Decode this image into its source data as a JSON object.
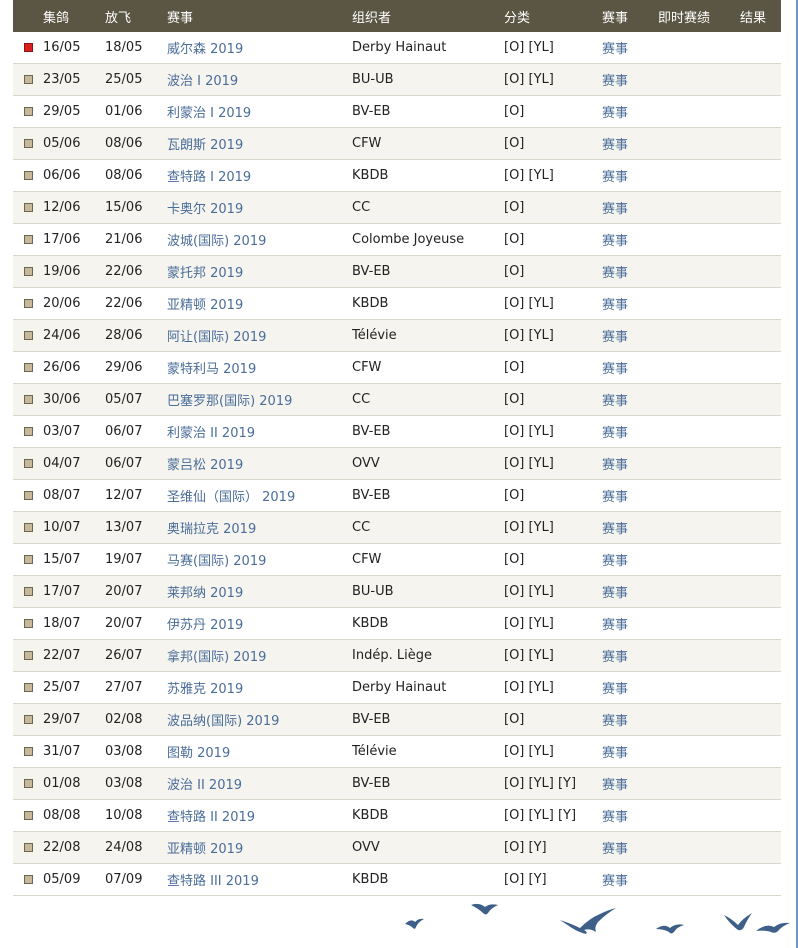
{
  "header": {
    "collect": "集鸽",
    "release": "放飞",
    "race": "赛事",
    "organizer": "组织者",
    "category": "分类",
    "race_link": "赛事",
    "live": "即时赛绩",
    "result": "结果"
  },
  "rows": [
    {
      "collect": "16/05",
      "release": "18/05",
      "race": "威尔森 2019",
      "organizer": "Derby Hainaut",
      "category": "[O] [YL]",
      "link": "赛事",
      "active": true
    },
    {
      "collect": "23/05",
      "release": "25/05",
      "race": "波治 I 2019",
      "organizer": "BU-UB",
      "category": "[O] [YL]",
      "link": "赛事"
    },
    {
      "collect": "29/05",
      "release": "01/06",
      "race": "利蒙治 I 2019",
      "organizer": "BV-EB",
      "category": "[O]",
      "link": "赛事"
    },
    {
      "collect": "05/06",
      "release": "08/06",
      "race": "瓦朗斯 2019",
      "organizer": "CFW",
      "category": "[O]",
      "link": "赛事"
    },
    {
      "collect": "06/06",
      "release": "08/06",
      "race": "查特路 I 2019",
      "organizer": "KBDB",
      "category": "[O] [YL]",
      "link": "赛事"
    },
    {
      "collect": "12/06",
      "release": "15/06",
      "race": "卡奥尔 2019",
      "organizer": "CC",
      "category": "[O]",
      "link": "赛事"
    },
    {
      "collect": "17/06",
      "release": "21/06",
      "race": "波城(国际) 2019",
      "organizer": "Colombe Joyeuse",
      "category": "[O]",
      "link": "赛事"
    },
    {
      "collect": "19/06",
      "release": "22/06",
      "race": "蒙托邦 2019",
      "organizer": "BV-EB",
      "category": "[O]",
      "link": "赛事"
    },
    {
      "collect": "20/06",
      "release": "22/06",
      "race": "亚精顿 2019",
      "organizer": "KBDB",
      "category": "[O] [YL]",
      "link": "赛事"
    },
    {
      "collect": "24/06",
      "release": "28/06",
      "race": "阿让(国际) 2019",
      "organizer": "Télévie",
      "category": "[O] [YL]",
      "link": "赛事"
    },
    {
      "collect": "26/06",
      "release": "29/06",
      "race": "蒙特利马 2019",
      "organizer": "CFW",
      "category": "[O]",
      "link": "赛事"
    },
    {
      "collect": "30/06",
      "release": "05/07",
      "race": "巴塞罗那(国际) 2019",
      "organizer": "CC",
      "category": "[O]",
      "link": "赛事"
    },
    {
      "collect": "03/07",
      "release": "06/07",
      "race": "利蒙治 II 2019",
      "organizer": "BV-EB",
      "category": "[O] [YL]",
      "link": "赛事"
    },
    {
      "collect": "04/07",
      "release": "06/07",
      "race": "蒙吕松 2019",
      "organizer": "OVV",
      "category": "[O] [YL]",
      "link": "赛事"
    },
    {
      "collect": "08/07",
      "release": "12/07",
      "race": "圣维仙（国际） 2019",
      "organizer": "BV-EB",
      "category": "[O]",
      "link": "赛事"
    },
    {
      "collect": "10/07",
      "release": "13/07",
      "race": "奥瑞拉克 2019",
      "organizer": "CC",
      "category": "[O] [YL]",
      "link": "赛事"
    },
    {
      "collect": "15/07",
      "release": "19/07",
      "race": "马赛(国际) 2019",
      "organizer": "CFW",
      "category": "[O]",
      "link": "赛事"
    },
    {
      "collect": "17/07",
      "release": "20/07",
      "race": "莱邦纳 2019",
      "organizer": "BU-UB",
      "category": "[O] [YL]",
      "link": "赛事"
    },
    {
      "collect": "18/07",
      "release": "20/07",
      "race": "伊苏丹 2019",
      "organizer": "KBDB",
      "category": "[O] [YL]",
      "link": "赛事"
    },
    {
      "collect": "22/07",
      "release": "26/07",
      "race": "拿邦(国际) 2019",
      "organizer": "Indép. Liège",
      "category": "[O] [YL]",
      "link": "赛事"
    },
    {
      "collect": "25/07",
      "release": "27/07",
      "race": "苏雅克 2019",
      "organizer": "Derby Hainaut",
      "category": "[O] [YL]",
      "link": "赛事"
    },
    {
      "collect": "29/07",
      "release": "02/08",
      "race": "波品纳(国际) 2019",
      "organizer": "BV-EB",
      "category": "[O]",
      "link": "赛事"
    },
    {
      "collect": "31/07",
      "release": "03/08",
      "race": "图勒 2019",
      "organizer": "Télévie",
      "category": "[O] [YL]",
      "link": "赛事"
    },
    {
      "collect": "01/08",
      "release": "03/08",
      "race": "波治 II 2019",
      "organizer": "BV-EB",
      "category": "[O] [YL] [Y]",
      "link": "赛事"
    },
    {
      "collect": "08/08",
      "release": "10/08",
      "race": "查特路 II 2019",
      "organizer": "KBDB",
      "category": "[O] [YL] [Y]",
      "link": "赛事"
    },
    {
      "collect": "22/08",
      "release": "24/08",
      "race": "亚精顿 2019",
      "organizer": "OVV",
      "category": "[O] [Y]",
      "link": "赛事"
    },
    {
      "collect": "05/09",
      "release": "07/09",
      "race": "查特路 III 2019",
      "organizer": "KBDB",
      "category": "[O] [Y]",
      "link": "赛事"
    }
  ],
  "colors": {
    "header_bg": "#5b5543",
    "link": "#4a6d99",
    "active_marker": "#d9201f",
    "marker": "#c7b89c",
    "bird": "#3e5f87"
  },
  "decorations": {
    "footer": "bird-silhouettes-icon"
  }
}
